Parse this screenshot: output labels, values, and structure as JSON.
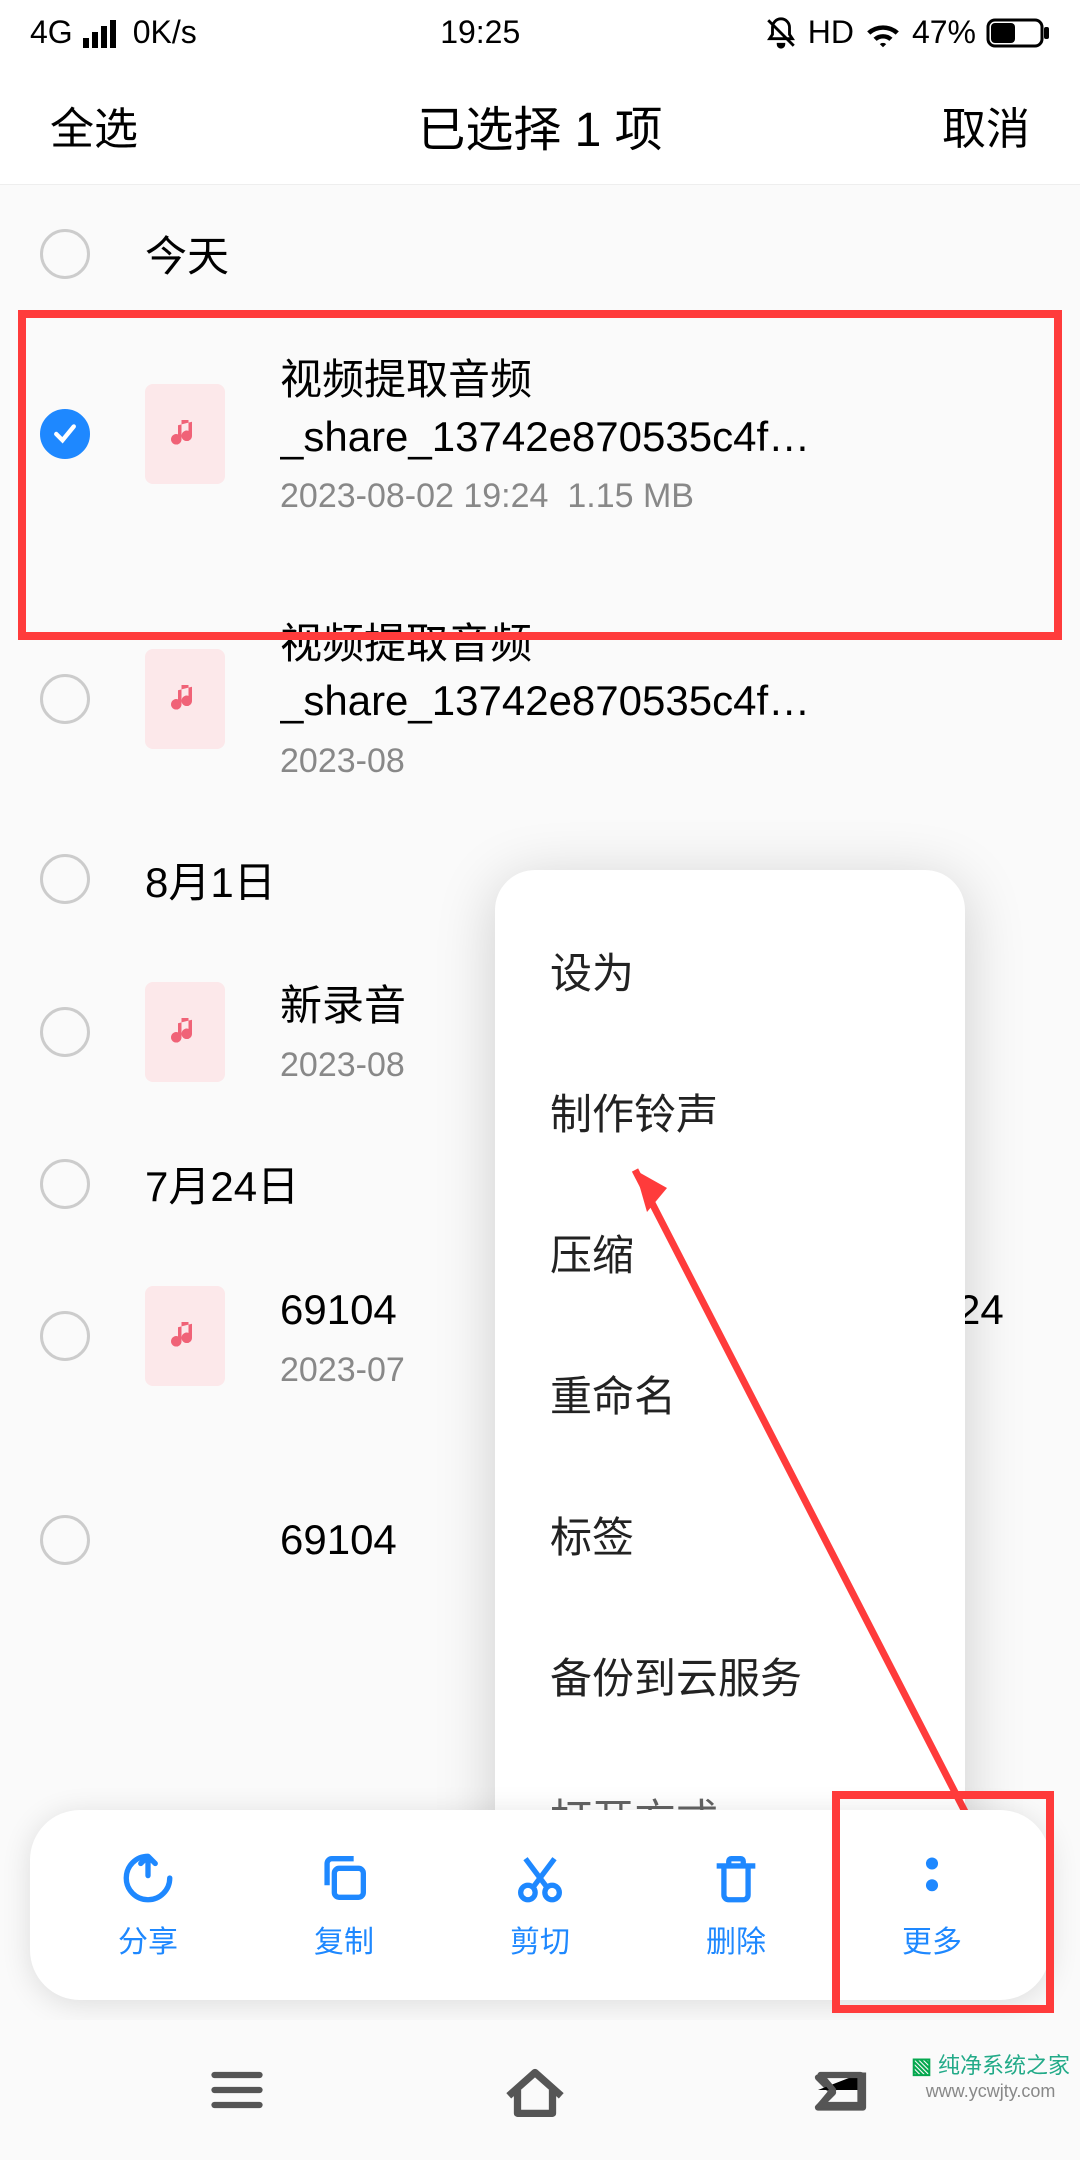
{
  "status": {
    "network": "4G",
    "speed": "0K/s",
    "time": "19:25",
    "hd": "HD",
    "battery": "47%"
  },
  "header": {
    "select_all": "全选",
    "title": "已选择 1 项",
    "cancel": "取消"
  },
  "sections": [
    {
      "title": "今天",
      "items": [
        {
          "name": "视频提取音频_share_13742e870535c4f…",
          "date": "2023-08-02 19:24",
          "size": "1.15 MB",
          "checked": true
        },
        {
          "name": "视频提取音频_share_13742e870535c4f…",
          "date": "2023-08",
          "size": "",
          "checked": false
        }
      ]
    },
    {
      "title": "8月1日",
      "items": [
        {
          "name": "新录音",
          "date": "2023-08",
          "size": "",
          "checked": false
        }
      ]
    },
    {
      "title": "7月24日",
      "items": [
        {
          "name": "69104                                    20230724",
          "date": "2023-07",
          "size": "",
          "checked": false
        },
        {
          "name": "69104                                    .mp3",
          "date": "",
          "size": "",
          "checked": false
        }
      ]
    }
  ],
  "popup": {
    "items": [
      "设为",
      "制作铃声",
      "压缩",
      "重命名",
      "标签",
      "备份到云服务",
      "打开方式"
    ]
  },
  "bottom": {
    "share": "分享",
    "copy": "复制",
    "cut": "剪切",
    "delete": "删除",
    "more": "更多"
  },
  "watermark": "纯净系统之家"
}
